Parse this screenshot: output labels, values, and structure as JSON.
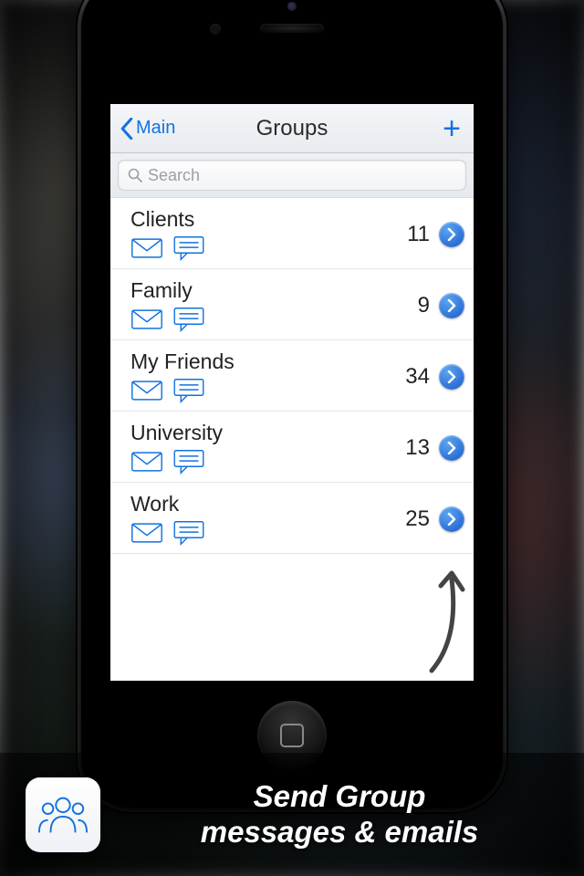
{
  "nav": {
    "back_label": "Main",
    "title": "Groups",
    "add_label": "+"
  },
  "search": {
    "placeholder": "Search"
  },
  "groups": [
    {
      "name": "Clients",
      "count": "11"
    },
    {
      "name": "Family",
      "count": "9"
    },
    {
      "name": "My Friends",
      "count": "34"
    },
    {
      "name": "University",
      "count": "13"
    },
    {
      "name": "Work",
      "count": "25"
    }
  ],
  "caption": {
    "line1": "Send Group",
    "line2": "messages & emails"
  }
}
